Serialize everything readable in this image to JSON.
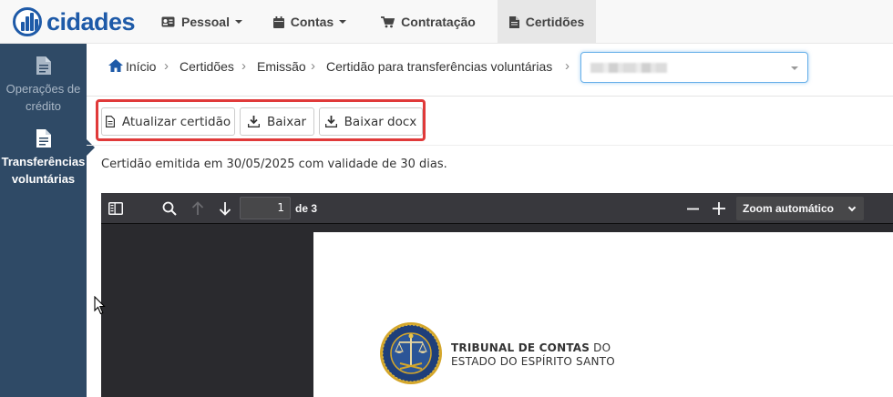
{
  "app": {
    "logo_text": "cidades"
  },
  "nav": {
    "items": [
      {
        "label": "Pessoal",
        "icon": "id-card-icon",
        "dropdown": true
      },
      {
        "label": "Contas",
        "icon": "calendar-icon",
        "dropdown": true
      },
      {
        "label": "Contratação",
        "icon": "cart-icon",
        "dropdown": false
      },
      {
        "label": "Certidões",
        "icon": "document-icon",
        "dropdown": false,
        "active": true
      }
    ]
  },
  "sidebar": {
    "items": [
      {
        "label": "Operações de crédito",
        "icon": "document-icon",
        "active": false
      },
      {
        "label": "Transferências voluntárias",
        "icon": "document-icon",
        "active": true
      }
    ]
  },
  "breadcrumb": {
    "home": "Início",
    "items": [
      "Certidões",
      "Emissão",
      "Certidão para transferências voluntárias"
    ]
  },
  "entity_select": {
    "value": ""
  },
  "toolbar": {
    "update_label": "Atualizar certidão",
    "download_label": "Baixar",
    "download_docx_label": "Baixar docx"
  },
  "status": {
    "message": "Certidão emitida em 30/05/2025 com validade de 30 dias."
  },
  "pdf_viewer": {
    "current_page": "1",
    "page_count_label": "de 3",
    "zoom_label": "Zoom automático"
  },
  "document": {
    "org_bold": "TRIBUNAL DE CONTAS",
    "org_rest": " DO",
    "org_line2": "ESTADO DO ESPÍRITO SANTO"
  },
  "colors": {
    "brand": "#1e5aa8",
    "sidebar_bg": "#2f4a66",
    "highlight": "#e03a3a",
    "viewer_bg": "#2a2a2e"
  }
}
